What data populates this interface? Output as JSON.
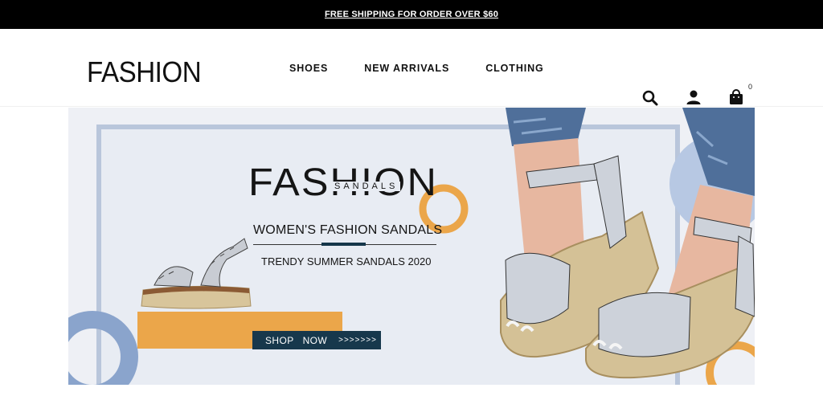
{
  "announcement": {
    "text": "FREE SHIPPING FOR ORDER OVER $60"
  },
  "header": {
    "logo": "FASHION",
    "nav": [
      {
        "label": "SHOES"
      },
      {
        "label": "NEW ARRIVALS"
      },
      {
        "label": "CLOTHING"
      }
    ],
    "icons": [
      "search-icon",
      "account-icon",
      "cart-icon"
    ],
    "cart_count": "0"
  },
  "hero": {
    "brand": "FASHION",
    "sub_brand": "SANDALS",
    "headline": "WOMEN'S FASHION SANDALS",
    "tagline": "TRENDY SUMMER SANDALS 2020",
    "cta_label": "SHOP   NOW",
    "cta_arrows": ">>>>>>>"
  },
  "colors": {
    "announcement_bg": "#000000",
    "accent_orange": "#eba64a",
    "accent_navy": "#17384c",
    "accent_blue": "#8aa4cc",
    "hero_bg": "#eef0f5"
  }
}
